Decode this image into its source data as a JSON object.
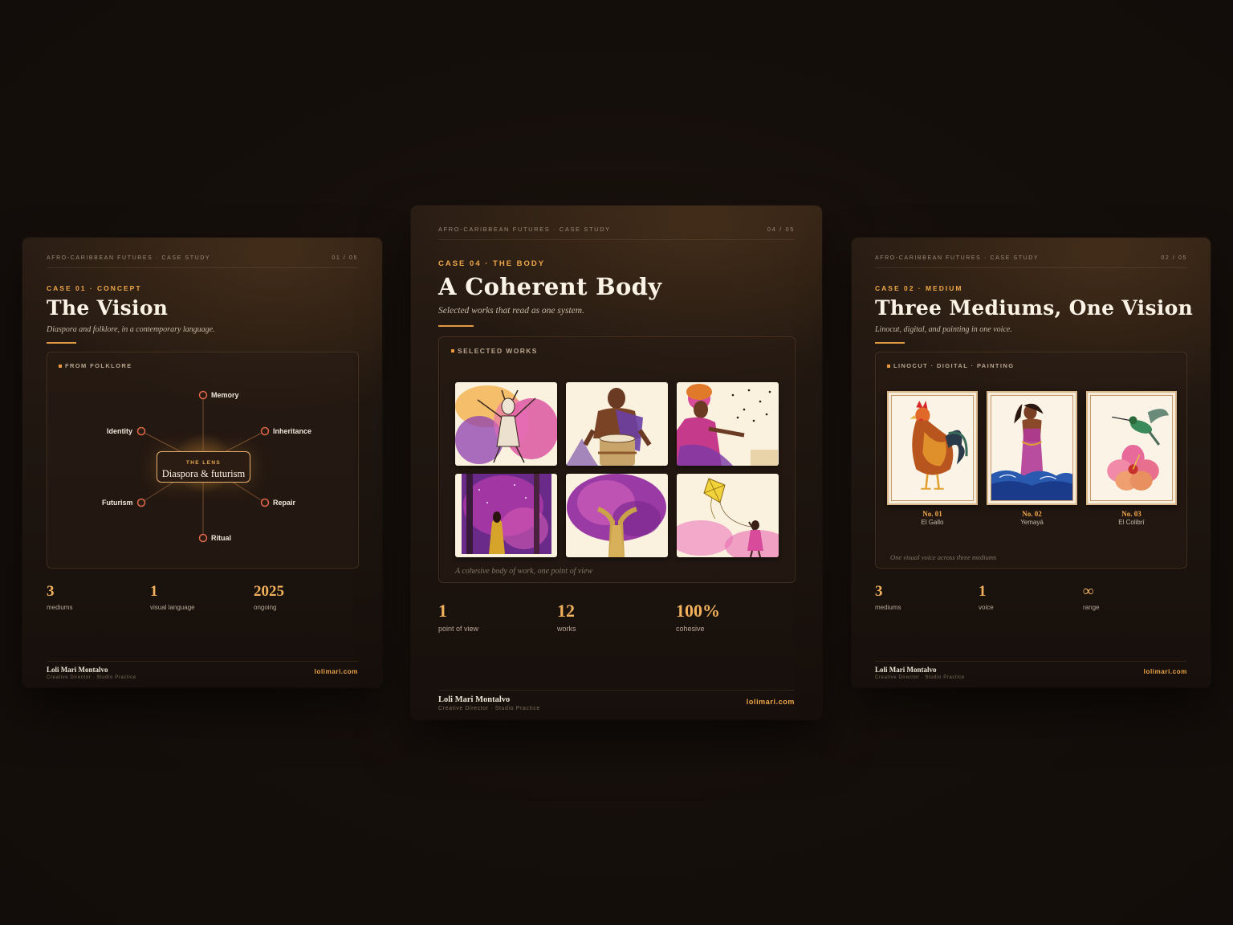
{
  "cards": {
    "left": {
      "series": "AFRO-CARIBBEAN FUTURES · CASE STUDY",
      "page": "01 / 05",
      "kicker": "CASE 01 · CONCEPT",
      "title": "The Vision",
      "subtitle": "Diaspora and folklore, in a contemporary language.",
      "panel_label": "FROM FOLKLORE",
      "lens_kicker": "THE LENS",
      "lens_title": "Diaspora & futurism",
      "nodes": [
        "Memory",
        "Identity",
        "Inheritance",
        "Futurism",
        "Repair",
        "Ritual"
      ],
      "stats": [
        {
          "value": "3",
          "label": "mediums"
        },
        {
          "value": "1",
          "label": "visual language"
        },
        {
          "value": "2025",
          "label": "ongoing"
        }
      ],
      "footer": {
        "name": "Loli Mari Montalvo",
        "role": "Creative Director · Studio Practice",
        "site": "lolimari.com"
      }
    },
    "center": {
      "series": "AFRO-CARIBBEAN FUTURES · CASE STUDY",
      "page": "04 / 05",
      "kicker": "CASE 04 · THE BODY",
      "title": "A Coherent Body",
      "subtitle": "Selected works that read as one system.",
      "panel_label": "SELECTED WORKS",
      "caption": "A cohesive body of work, one point of view",
      "stats": [
        {
          "value": "1",
          "label": "point of view"
        },
        {
          "value": "12",
          "label": "works"
        },
        {
          "value": "100%",
          "label": "cohesive"
        }
      ],
      "footer": {
        "name": "Loli Mari Montalvo",
        "role": "Creative Director · Studio Practice",
        "site": "lolimari.com"
      }
    },
    "right": {
      "series": "AFRO-CARIBBEAN FUTURES · CASE STUDY",
      "page": "02 / 05",
      "kicker": "CASE 02 · MEDIUM",
      "title": "Three Mediums, One Vision",
      "subtitle": "Linocut, digital, and painting in one voice.",
      "panel_label": "LINOCUT · DIGITAL · PAINTING",
      "plates": [
        {
          "no": "No. 01",
          "name": "El Gallo"
        },
        {
          "no": "No. 02",
          "name": "Yemayá"
        },
        {
          "no": "No. 03",
          "name": "El Colibrí"
        }
      ],
      "caption": "One visual voice across three mediums",
      "stats": [
        {
          "value": "3",
          "label": "mediums"
        },
        {
          "value": "1",
          "label": "voice"
        },
        {
          "value": "∞",
          "label": "range"
        }
      ],
      "footer": {
        "name": "Loli Mari Montalvo",
        "role": "Creative Director · Studio Practice",
        "site": "lolimari.com"
      }
    }
  },
  "colors": {
    "accent": "#f0a84a",
    "background": "#150f0b",
    "card": "#1f1610",
    "node_ring": "#e0684a"
  }
}
